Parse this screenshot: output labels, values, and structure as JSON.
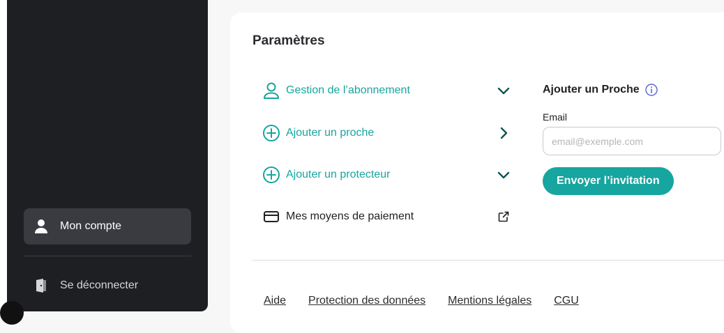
{
  "sidebar": {
    "items": [
      {
        "label": "Mon compte",
        "icon": "user-icon"
      },
      {
        "label": "Se déconnecter",
        "icon": "logout-door-icon"
      }
    ]
  },
  "settings": {
    "title": "Paramètres",
    "menu": [
      {
        "label": "Gestion de l’abonnement",
        "icon": "user-outline-icon",
        "chevron": "chevron-down-icon"
      },
      {
        "label": "Ajouter un proche",
        "icon": "plus-circle-icon",
        "chevron": "chevron-right-icon"
      },
      {
        "label": "Ajouter un protecteur",
        "icon": "plus-circle-icon",
        "chevron": "chevron-down-icon"
      },
      {
        "label": "Mes moyens de paiement",
        "icon": "credit-card-icon",
        "chevron": "external-link-icon"
      }
    ]
  },
  "add_relative": {
    "title": "Ajouter un Proche",
    "email_label": "Email",
    "email_value": "",
    "email_placeholder": "email@exemple.com",
    "submit_label": "Envoyer l’invitation"
  },
  "footer": {
    "links": [
      "Aide",
      "Protection des données",
      "Mentions légales",
      "CGU"
    ]
  },
  "colors": {
    "accent": "#17a59f",
    "sidebar_bg": "#1e1f23",
    "sidebar_active_bg": "#393b41",
    "page_bg": "#f7f7f8"
  }
}
